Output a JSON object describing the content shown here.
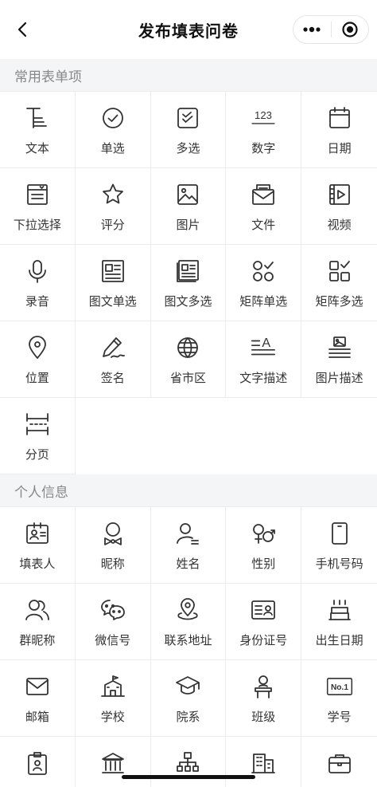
{
  "nav": {
    "title": "发布填表问卷"
  },
  "sections": [
    {
      "header": "常用表单项",
      "items": [
        {
          "label": "文本",
          "icon": "text-icon"
        },
        {
          "label": "单选",
          "icon": "radio-check-icon"
        },
        {
          "label": "多选",
          "icon": "checkbox-icon"
        },
        {
          "label": "数字",
          "icon": "number-icon",
          "glyph": "123"
        },
        {
          "label": "日期",
          "icon": "calendar-icon"
        },
        {
          "label": "下拉选择",
          "icon": "dropdown-icon"
        },
        {
          "label": "评分",
          "icon": "star-icon"
        },
        {
          "label": "图片",
          "icon": "image-icon"
        },
        {
          "label": "文件",
          "icon": "file-icon"
        },
        {
          "label": "视频",
          "icon": "video-icon"
        },
        {
          "label": "录音",
          "icon": "microphone-icon"
        },
        {
          "label": "图文单选",
          "icon": "image-text-single-icon"
        },
        {
          "label": "图文多选",
          "icon": "image-text-multi-icon"
        },
        {
          "label": "矩阵单选",
          "icon": "matrix-single-icon"
        },
        {
          "label": "矩阵多选",
          "icon": "matrix-multi-icon"
        },
        {
          "label": "位置",
          "icon": "location-icon"
        },
        {
          "label": "签名",
          "icon": "signature-icon"
        },
        {
          "label": "省市区",
          "icon": "globe-icon"
        },
        {
          "label": "文字描述",
          "icon": "text-description-icon",
          "glyph": "A"
        },
        {
          "label": "图片描述",
          "icon": "image-description-icon"
        },
        {
          "label": "分页",
          "icon": "pagination-icon"
        }
      ]
    },
    {
      "header": "个人信息",
      "items": [
        {
          "label": "填表人",
          "icon": "id-badge-icon"
        },
        {
          "label": "昵称",
          "icon": "nickname-icon"
        },
        {
          "label": "姓名",
          "icon": "user-name-icon"
        },
        {
          "label": "性别",
          "icon": "gender-icon"
        },
        {
          "label": "手机号码",
          "icon": "phone-icon"
        },
        {
          "label": "群昵称",
          "icon": "group-icon"
        },
        {
          "label": "微信号",
          "icon": "wechat-icon"
        },
        {
          "label": "联系地址",
          "icon": "address-icon"
        },
        {
          "label": "身份证号",
          "icon": "id-card-icon"
        },
        {
          "label": "出生日期",
          "icon": "birthday-cake-icon"
        },
        {
          "label": "邮箱",
          "icon": "mail-icon"
        },
        {
          "label": "学校",
          "icon": "school-icon"
        },
        {
          "label": "院系",
          "icon": "graduation-cap-icon"
        },
        {
          "label": "班级",
          "icon": "class-icon"
        },
        {
          "label": "学号",
          "icon": "student-number-icon",
          "glyph": "No.1"
        },
        {
          "label": "",
          "icon": "badge-icon"
        },
        {
          "label": "",
          "icon": "bank-icon"
        },
        {
          "label": "",
          "icon": "org-chart-icon"
        },
        {
          "label": "",
          "icon": "building-icon"
        },
        {
          "label": "",
          "icon": "briefcase-icon"
        }
      ]
    }
  ]
}
